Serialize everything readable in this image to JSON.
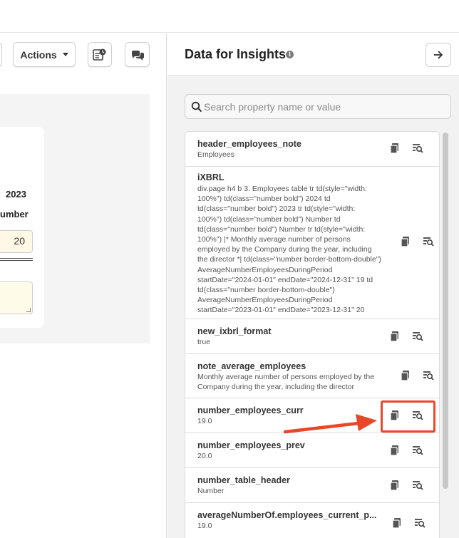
{
  "toolbar": {
    "actions_label": "Actions"
  },
  "form": {
    "year_label": "2023",
    "number_label": "umber",
    "number_value": "20"
  },
  "panel": {
    "title": "Data for Insights",
    "info_glyph": "i"
  },
  "search": {
    "placeholder": "Search property name or value"
  },
  "items": [
    {
      "name": "header_employees_note",
      "value": "Employees"
    },
    {
      "name": "iXBRL",
      "value": "div.page h4 b 3. Employees table tr td(style=\"width: 100%\") td(class=\"number bold\") 2024 td td(class=\"number bold\") 2023 tr td(style=\"width: 100%\") td(class=\"number bold\") Number td td(class=\"number bold\") Number tr td(style=\"width: 100%\") |* Monthly average number of persons employed by the Company during the year, including the director *| td(class=\"number border-bottom-double\") AverageNumberEmployeesDuringPeriod startDate=\"2024-01-01\" endDate=\"2024-12-31\" 19 td td(class=\"number border-bottom-double\") AverageNumberEmployeesDuringPeriod startDate=\"2023-01-01\" endDate=\"2023-12-31\" 20"
    },
    {
      "name": "new_ixbrl_format",
      "value": "true"
    },
    {
      "name": "note_average_employees",
      "value": "Monthly average number of persons employed by the Company during the year, including the director"
    },
    {
      "name": "number_employees_curr",
      "value": "19.0"
    },
    {
      "name": "number_employees_prev",
      "value": "20.0"
    },
    {
      "name": "number_table_header",
      "value": "Number"
    },
    {
      "name": "averageNumberOf.employees_current_p...",
      "value": "19.0"
    }
  ],
  "colors": {
    "highlight": "#e8472a",
    "panel_bg": "#f2f2f2",
    "input_bg": "#fff8e6"
  },
  "icons": {
    "copy": "copy-icon",
    "inspect": "inspect-icon",
    "arrow": "arrow-right-icon",
    "search": "search-icon"
  }
}
